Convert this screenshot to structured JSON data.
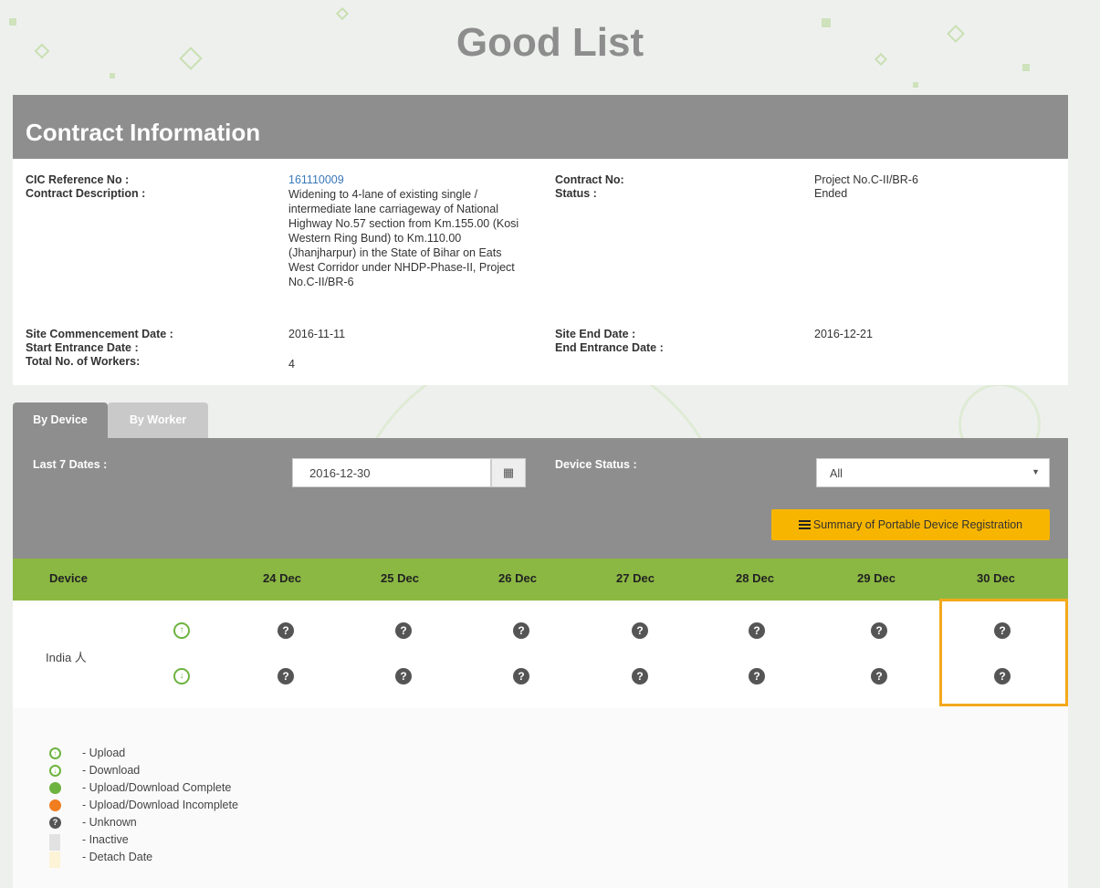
{
  "page": {
    "title": "Good List"
  },
  "contract": {
    "header": "Contract Information",
    "labels": {
      "cic_ref": "CIC Reference No :",
      "description": "Contract Description :",
      "contract_no": "Contract No:",
      "status": "Status :",
      "site_commencement": "Site Commencement Date :",
      "start_entrance": "Start Entrance Date :",
      "total_workers": "Total No. of Workers:",
      "site_end": "Site End Date :",
      "end_entrance": "End Entrance Date :"
    },
    "values": {
      "cic_ref": "161110009",
      "description": "Widening to 4-lane of existing single / intermediate lane carriageway of National Highway No.57 section from Km.155.00 (Kosi Western Ring Bund) to Km.110.00 (Jhanjharpur) in the State of Bihar on Eats West Corridor under NHDP-Phase-II, Project No.C-II/BR-6",
      "contract_no": "Project No.C-II/BR-6",
      "status": "Ended",
      "site_commencement": "2016-11-11",
      "start_entrance": "",
      "total_workers": "4",
      "site_end": "2016-12-21",
      "end_entrance": ""
    }
  },
  "tabs": [
    {
      "label": "By Device",
      "active": true
    },
    {
      "label": "By Worker",
      "active": false
    }
  ],
  "filters": {
    "last_dates_label": "Last 7 Dates :",
    "date_value": "2016-12-30",
    "device_status_label": "Device Status :",
    "device_status_value": "All",
    "summary_button": "Summary of Portable Device Registration"
  },
  "grid": {
    "columns": [
      "Device",
      "24 Dec",
      "25 Dec",
      "26 Dec",
      "27 Dec",
      "28 Dec",
      "29 Dec",
      "30 Dec"
    ],
    "rows": [
      {
        "device": "India 人",
        "upload": [
          "unknown",
          "unknown",
          "unknown",
          "unknown",
          "unknown",
          "unknown",
          "unknown"
        ],
        "download": [
          "unknown",
          "unknown",
          "unknown",
          "unknown",
          "unknown",
          "unknown",
          "unknown"
        ]
      }
    ],
    "highlight_color": "#f3a91a",
    "header_color": "#8bb843"
  },
  "legend": [
    {
      "icon": "upload-icon",
      "text": "- Upload"
    },
    {
      "icon": "download-icon",
      "text": "- Download"
    },
    {
      "icon": "complete-icon",
      "text": "- Upload/Download Complete"
    },
    {
      "icon": "incomplete-icon",
      "text": "- Upload/Download Incomplete"
    },
    {
      "icon": "unknown-icon",
      "text": "- Unknown"
    },
    {
      "icon": "inactive-swatch",
      "text": "- Inactive"
    },
    {
      "icon": "detach-swatch",
      "text": "- Detach Date"
    }
  ]
}
